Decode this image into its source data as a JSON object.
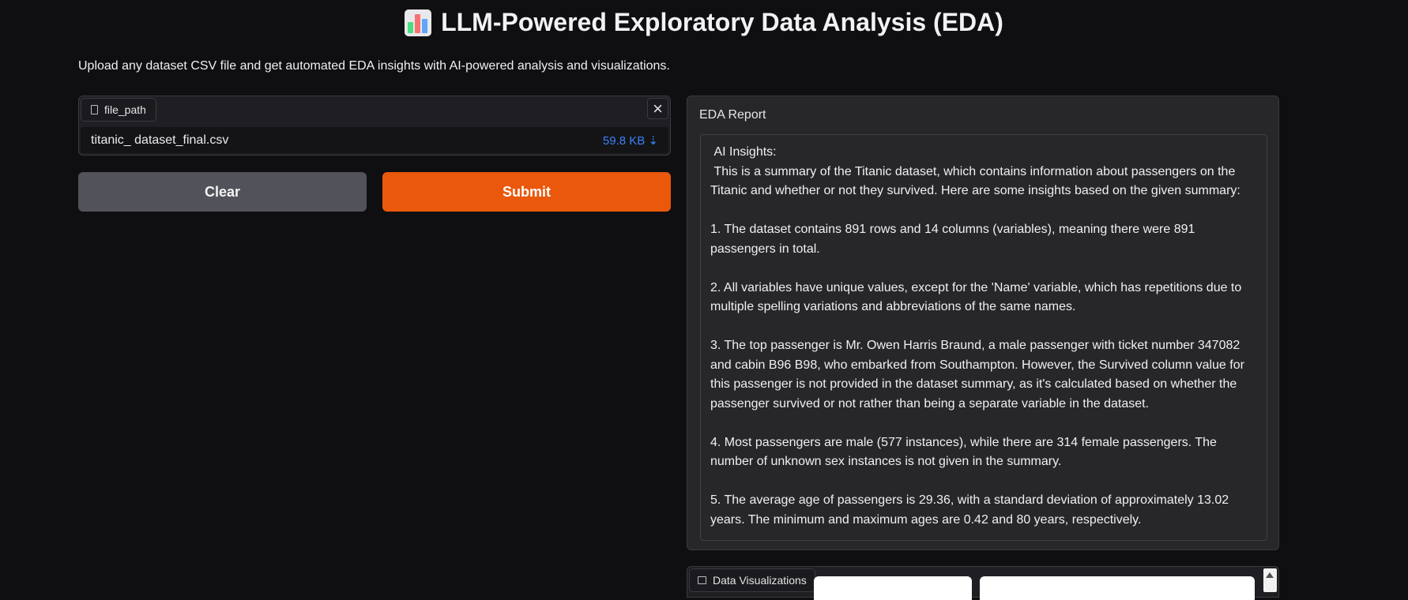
{
  "app": {
    "title": "LLM-Powered Exploratory Data Analysis (EDA)",
    "description": "Upload any dataset CSV file and get automated EDA insights with AI-powered analysis and visualizations."
  },
  "file_input": {
    "label": "file_path",
    "file_name": "titanic_ dataset_final.csv",
    "file_size": "59.8 KB ⇣"
  },
  "buttons": {
    "clear": "Clear",
    "submit": "Submit"
  },
  "report": {
    "label": "EDA Report",
    "text": " AI Insights:\n This is a summary of the Titanic dataset, which contains information about passengers on the Titanic and whether or not they survived. Here are some insights based on the given summary:\n\n1. The dataset contains 891 rows and 14 columns (variables), meaning there were 891 passengers in total.\n\n2. All variables have unique values, except for the 'Name' variable, which has repetitions due to multiple spelling variations and abbreviations of the same names.\n\n3. The top passenger is Mr. Owen Harris Braund, a male passenger with ticket number 347082 and cabin B96 B98, who embarked from Southampton. However, the Survived column value for this passenger is not provided in the dataset summary, as it's calculated based on whether the passenger survived or not rather than being a separate variable in the dataset.\n\n4. Most passengers are male (577 instances), while there are 314 female passengers. The number of unknown sex instances is not given in the summary.\n\n5. The average age of passengers is 29.36, with a standard deviation of approximately 13.02 years. The minimum and maximum ages are 0.42 and 80 years, respectively."
  },
  "visualizations": {
    "label": "Data Visualizations"
  },
  "colors": {
    "accent": "#ea580c",
    "link": "#3b82f6",
    "background": "#0f0f11"
  }
}
